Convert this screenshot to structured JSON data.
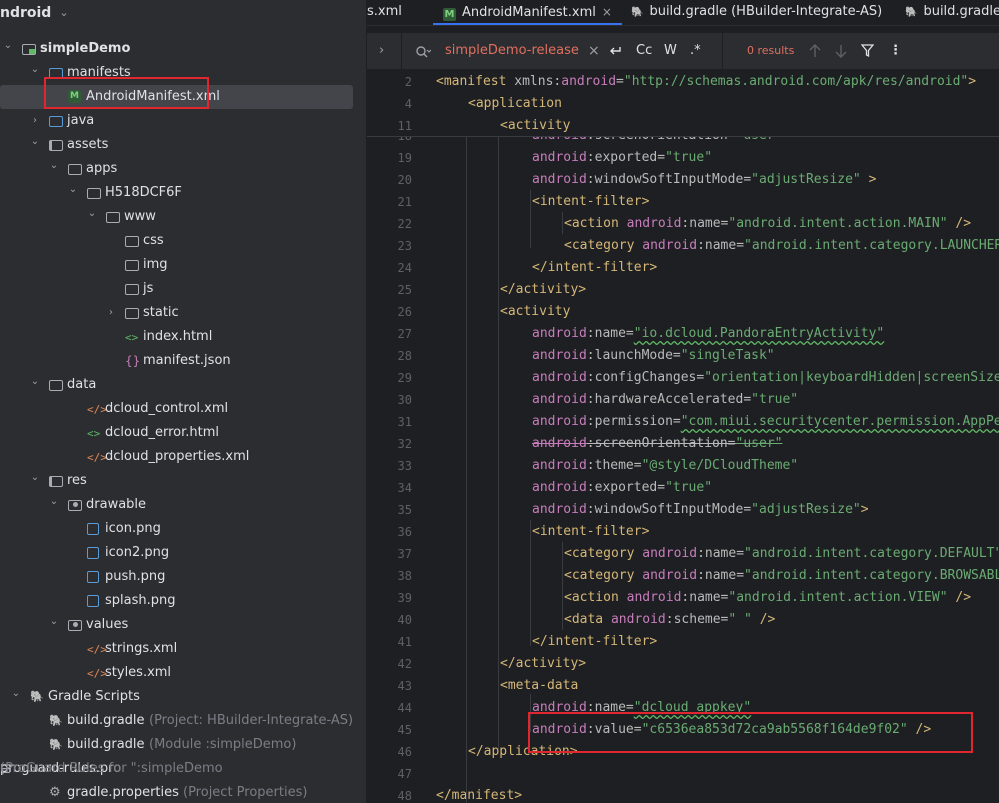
{
  "project": {
    "title": "ndroid"
  },
  "tree": [
    {
      "label": "simpleDemo",
      "indent": 0,
      "arrow": "open",
      "icon": "module-icon",
      "bold": true
    },
    {
      "label": "manifests",
      "indent": 1,
      "arrow": "open",
      "icon": "folder-blue-icon"
    },
    {
      "label": "AndroidManifest.xml",
      "indent": 2,
      "arrow": "",
      "icon": "manifest-file-icon",
      "selected": true
    },
    {
      "label": "java",
      "indent": 1,
      "arrow": "closed",
      "icon": "folder-blue-icon"
    },
    {
      "label": "assets",
      "indent": 1,
      "arrow": "open",
      "icon": "folder-res-icon"
    },
    {
      "label": "apps",
      "indent": 2,
      "arrow": "open",
      "icon": "folder-icon"
    },
    {
      "label": "H518DCF6F",
      "indent": 3,
      "arrow": "open",
      "icon": "folder-icon"
    },
    {
      "label": "www",
      "indent": 4,
      "arrow": "open",
      "icon": "folder-icon"
    },
    {
      "label": "css",
      "indent": 5,
      "arrow": "",
      "icon": "folder-icon"
    },
    {
      "label": "img",
      "indent": 5,
      "arrow": "",
      "icon": "folder-icon"
    },
    {
      "label": "js",
      "indent": 5,
      "arrow": "",
      "icon": "folder-icon"
    },
    {
      "label": "static",
      "indent": 5,
      "arrow": "closed",
      "icon": "folder-icon"
    },
    {
      "label": "index.html",
      "indent": 5,
      "arrow": "",
      "icon": "html-file-icon"
    },
    {
      "label": "manifest.json",
      "indent": 5,
      "arrow": "",
      "icon": "json-file-icon"
    },
    {
      "label": "data",
      "indent": 1,
      "arrow": "open",
      "icon": "folder-icon"
    },
    {
      "label": "dcloud_control.xml",
      "indent": 3,
      "arrow": "",
      "icon": "xml-file-icon"
    },
    {
      "label": "dcloud_error.html",
      "indent": 3,
      "arrow": "",
      "icon": "html-file-icon"
    },
    {
      "label": "dcloud_properties.xml",
      "indent": 3,
      "arrow": "",
      "icon": "xml-file-icon"
    },
    {
      "label": "res",
      "indent": 1,
      "arrow": "open",
      "icon": "folder-res-icon"
    },
    {
      "label": "drawable",
      "indent": 2,
      "arrow": "open",
      "icon": "folder-pkg-icon"
    },
    {
      "label": "icon.png",
      "indent": 3,
      "arrow": "",
      "icon": "image-file-icon"
    },
    {
      "label": "icon2.png",
      "indent": 3,
      "arrow": "",
      "icon": "image-file-icon"
    },
    {
      "label": "push.png",
      "indent": 3,
      "arrow": "",
      "icon": "image-file-icon"
    },
    {
      "label": "splash.png",
      "indent": 3,
      "arrow": "",
      "icon": "image-file-icon"
    },
    {
      "label": "values",
      "indent": 2,
      "arrow": "open",
      "icon": "folder-pkg-icon"
    },
    {
      "label": "strings.xml",
      "indent": 3,
      "arrow": "",
      "icon": "xml-file-icon"
    },
    {
      "label": "styles.xml",
      "indent": 3,
      "arrow": "",
      "icon": "xml-file-icon"
    },
    {
      "label": "Gradle Scripts",
      "indent": 0,
      "arrow": "open",
      "icon": "gradle-icon"
    },
    {
      "label": "build.gradle",
      "hint": "(Project: HBuilder-Integrate-AS)",
      "indent": 1,
      "arrow": "",
      "icon": "gradle-file-icon"
    },
    {
      "label": "build.gradle",
      "hint": "(Module :simpleDemo)",
      "indent": 1,
      "arrow": "",
      "icon": "gradle-file-icon"
    },
    {
      "label": "proguard-rules.pro",
      "hint": "(ProGuard Rules for \":simpleDemo",
      ",indent": 1,
      "arrow": "",
      "icon": "list-file-icon"
    },
    {
      "label": "gradle.properties",
      "hint": "(Project Properties)",
      "indent": 1,
      "arrow": "",
      "icon": "gear-file-icon"
    }
  ],
  "tabs": [
    {
      "label": "s.xml",
      "active": false,
      "icon": ""
    },
    {
      "label": "AndroidManifest.xml",
      "active": true,
      "icon": "M"
    },
    {
      "label": "build.gradle (HBuilder-Integrate-AS)",
      "active": false,
      "icon": "gradle"
    },
    {
      "label": "build.gradle (",
      "active": false,
      "icon": "gradle"
    }
  ],
  "search": {
    "expand": "›",
    "query": "simpleDemo-release",
    "clear": "×",
    "regex_toggle_case": "Cc",
    "regex_toggle_word": "W",
    "regex_toggle_re": ".*",
    "results": "0 results"
  },
  "sticky": [
    {
      "n": "2",
      "indent": 0,
      "tokens": [
        [
          "tag",
          "<manifest "
        ],
        [
          "at",
          "xmlns:"
        ],
        [
          "ns",
          "android"
        ],
        [
          "at",
          "="
        ],
        [
          "str",
          "\"http://schemas.android.com/apk/res/android\""
        ],
        [
          "tag",
          ">"
        ]
      ]
    },
    {
      "n": "4",
      "indent": 1,
      "tokens": [
        [
          "tag",
          "<application"
        ]
      ]
    },
    {
      "n": "11",
      "indent": 2,
      "tokens": [
        [
          "tag",
          "<activity"
        ]
      ]
    }
  ],
  "lines": [
    {
      "n": "19",
      "indent": 3,
      "tokens": [
        [
          "ns",
          "android"
        ],
        [
          "at",
          ":exported="
        ],
        [
          "str",
          "\"true\""
        ]
      ]
    },
    {
      "n": "20",
      "indent": 3,
      "tokens": [
        [
          "ns",
          "android"
        ],
        [
          "at",
          ":windowSoftInputMode="
        ],
        [
          "str",
          "\"adjustResize\""
        ],
        [
          "tag",
          " >"
        ]
      ]
    },
    {
      "n": "21",
      "indent": 3,
      "tokens": [
        [
          "tag",
          "<intent-filter>"
        ]
      ]
    },
    {
      "n": "22",
      "indent": 4,
      "tokens": [
        [
          "tag",
          "<action "
        ],
        [
          "ns",
          "android"
        ],
        [
          "at",
          ":name="
        ],
        [
          "str",
          "\"android.intent.action.MAIN\""
        ],
        [
          "tag",
          " />"
        ]
      ]
    },
    {
      "n": "23",
      "indent": 4,
      "tokens": [
        [
          "tag",
          "<category "
        ],
        [
          "ns",
          "android"
        ],
        [
          "at",
          ":name="
        ],
        [
          "str",
          "\"android.intent.category.LAUNCHER\""
        ],
        [
          "tag",
          " />"
        ]
      ]
    },
    {
      "n": "24",
      "indent": 3,
      "tokens": [
        [
          "tag",
          "</intent-filter>"
        ]
      ]
    },
    {
      "n": "25",
      "indent": 2,
      "tokens": [
        [
          "tag",
          "</activity>"
        ]
      ]
    },
    {
      "n": "26",
      "indent": 2,
      "tokens": [
        [
          "tag",
          "<activity"
        ]
      ]
    },
    {
      "n": "27",
      "indent": 3,
      "tokens": [
        [
          "ns",
          "android"
        ],
        [
          "at",
          ":name="
        ],
        [
          "str",
          "\"io.dcloud.PandoraEntryActivity\""
        ]
      ]
    },
    {
      "n": "28",
      "indent": 3,
      "tokens": [
        [
          "ns",
          "android"
        ],
        [
          "at",
          ":launchMode="
        ],
        [
          "str",
          "\"singleTask\""
        ]
      ]
    },
    {
      "n": "29",
      "indent": 3,
      "tokens": [
        [
          "ns",
          "android"
        ],
        [
          "at",
          ":configChanges="
        ],
        [
          "str",
          "\"orientation|keyboardHidden|screenSize\""
        ]
      ]
    },
    {
      "n": "30",
      "indent": 3,
      "tokens": [
        [
          "ns",
          "android"
        ],
        [
          "at",
          ":hardwareAccelerated="
        ],
        [
          "str",
          "\"true\""
        ]
      ]
    },
    {
      "n": "31",
      "indent": 3,
      "tokens": [
        [
          "ns",
          "android"
        ],
        [
          "at",
          ":permission="
        ],
        [
          "str",
          "\"com.miui.securitycenter.permission.AppPermissions\""
        ]
      ]
    },
    {
      "n": "32",
      "indent": 3,
      "strike": true,
      "tokens": [
        [
          "ns",
          "android"
        ],
        [
          "at",
          ":screenOrientation="
        ],
        [
          "str",
          "\"user\""
        ]
      ]
    },
    {
      "n": "33",
      "indent": 3,
      "tokens": [
        [
          "ns",
          "android"
        ],
        [
          "at",
          ":theme="
        ],
        [
          "str",
          "\"@style/DCloudTheme\""
        ]
      ]
    },
    {
      "n": "34",
      "indent": 3,
      "tokens": [
        [
          "ns",
          "android"
        ],
        [
          "at",
          ":exported="
        ],
        [
          "str",
          "\"true\""
        ]
      ]
    },
    {
      "n": "35",
      "indent": 3,
      "tokens": [
        [
          "ns",
          "android"
        ],
        [
          "at",
          ":windowSoftInputMode="
        ],
        [
          "str",
          "\"adjustResize\""
        ],
        [
          "tag",
          ">"
        ]
      ]
    },
    {
      "n": "36",
      "indent": 3,
      "tokens": [
        [
          "tag",
          "<intent-filter>"
        ]
      ]
    },
    {
      "n": "37",
      "indent": 4,
      "tokens": [
        [
          "tag",
          "<category "
        ],
        [
          "ns",
          "android"
        ],
        [
          "at",
          ":name="
        ],
        [
          "str",
          "\"android.intent.category.DEFAULT\""
        ],
        [
          "tag",
          " />"
        ]
      ]
    },
    {
      "n": "38",
      "indent": 4,
      "tokens": [
        [
          "tag",
          "<category "
        ],
        [
          "ns",
          "android"
        ],
        [
          "at",
          ":name="
        ],
        [
          "str",
          "\"android.intent.category.BROWSABLE\""
        ],
        [
          "tag",
          " />"
        ]
      ]
    },
    {
      "n": "39",
      "indent": 4,
      "tokens": [
        [
          "tag",
          "<action "
        ],
        [
          "ns",
          "android"
        ],
        [
          "at",
          ":name="
        ],
        [
          "str",
          "\"android.intent.action.VIEW\""
        ],
        [
          "tag",
          " />"
        ]
      ]
    },
    {
      "n": "40",
      "indent": 4,
      "tokens": [
        [
          "tag",
          "<data "
        ],
        [
          "ns",
          "android"
        ],
        [
          "at",
          ":scheme="
        ],
        [
          "str",
          "\" \""
        ],
        [
          "tag",
          " />"
        ]
      ]
    },
    {
      "n": "41",
      "indent": 3,
      "tokens": [
        [
          "tag",
          "</intent-filter>"
        ]
      ]
    },
    {
      "n": "42",
      "indent": 2,
      "tokens": [
        [
          "tag",
          "</activity>"
        ]
      ]
    },
    {
      "n": "43",
      "indent": 2,
      "tokens": [
        [
          "tag",
          "<meta-data"
        ]
      ]
    },
    {
      "n": "44",
      "indent": 3,
      "tokens": [
        [
          "ns",
          "android"
        ],
        [
          "at",
          ":name="
        ],
        [
          "str",
          "\"dcloud_appkey\""
        ]
      ]
    },
    {
      "n": "45",
      "indent": 3,
      "tokens": [
        [
          "ns",
          "android"
        ],
        [
          "at",
          ":value="
        ],
        [
          "str",
          "\"c6536ea853d72ca9ab5568f164de9f02\""
        ],
        [
          "tag",
          " />"
        ]
      ]
    },
    {
      "n": "46",
      "indent": 1,
      "tokens": [
        [
          "tag",
          "</application>"
        ]
      ]
    },
    {
      "n": "47",
      "indent": 0,
      "tokens": []
    },
    {
      "n": "48",
      "indent": 0,
      "tokens": [
        [
          "tag",
          "</manifest>"
        ]
      ]
    }
  ],
  "hidden_line_18": {
    "n": "18",
    "tokens": [
      [
        "ns",
        "android"
      ],
      [
        "at",
        ":screenOrientation="
      ],
      [
        "str",
        "\"user\""
      ]
    ]
  },
  "colors": {
    "accent": "#3574f0",
    "highlight": "#e0262e",
    "string": "#6aab73",
    "tag": "#d5b778",
    "namespace": "#c77dbb"
  }
}
